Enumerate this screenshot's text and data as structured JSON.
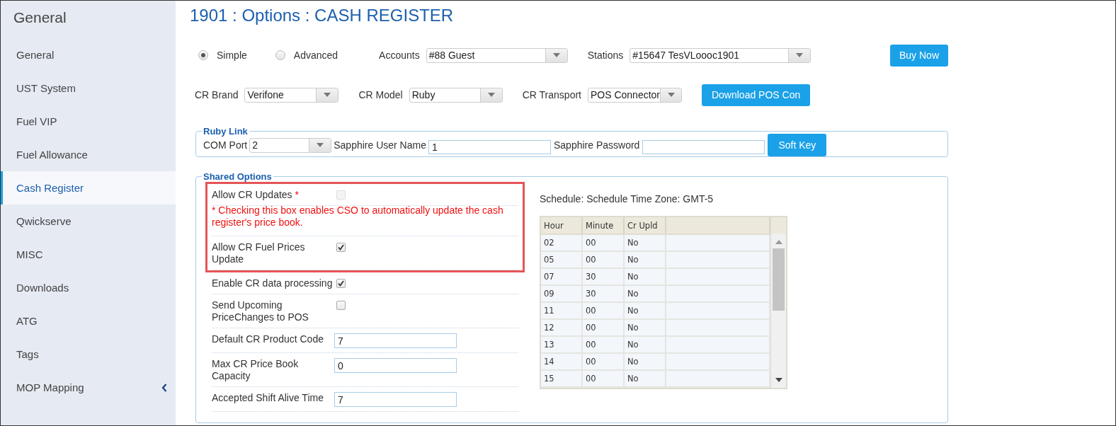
{
  "sidebar": {
    "title": "General",
    "items": [
      {
        "label": "General",
        "selected": false,
        "expandable": false
      },
      {
        "label": "UST System",
        "selected": false,
        "expandable": false
      },
      {
        "label": "Fuel VIP",
        "selected": false,
        "expandable": false
      },
      {
        "label": "Fuel Allowance",
        "selected": false,
        "expandable": false
      },
      {
        "label": "Cash Register",
        "selected": true,
        "expandable": false
      },
      {
        "label": "Qwickserve",
        "selected": false,
        "expandable": false
      },
      {
        "label": "MISC",
        "selected": false,
        "expandable": false
      },
      {
        "label": "Downloads",
        "selected": false,
        "expandable": false
      },
      {
        "label": "ATG",
        "selected": false,
        "expandable": false
      },
      {
        "label": "Tags",
        "selected": false,
        "expandable": false
      },
      {
        "label": "MOP Mapping",
        "selected": false,
        "expandable": true
      }
    ]
  },
  "page_title": "1901 : Options : CASH REGISTER",
  "mode": [
    {
      "label": "Simple",
      "selected": true
    },
    {
      "label": "Advanced",
      "selected": false
    }
  ],
  "selectors": [
    {
      "label": "Accounts",
      "value": "#88 Guest"
    },
    {
      "label": "Stations",
      "value": "#15647 TesVLoooc1901"
    }
  ],
  "buy_button": "Buy Now",
  "cr_settings": [
    {
      "label": "CR Brand",
      "value": "Verifone"
    },
    {
      "label": "CR Model",
      "value": "Ruby"
    },
    {
      "label": "CR Transport",
      "value": "POS Connector"
    }
  ],
  "download_button": "Download POS Con",
  "ruby_link": {
    "legend": "Ruby Link",
    "com_port": {
      "label": "COM Port",
      "value": "2"
    },
    "user_name": {
      "label": "Sapphire User Name",
      "value": "1"
    },
    "password": {
      "label": "Sapphire Password"
    },
    "button": "Soft Key"
  },
  "shared_options": {
    "legend": "Shared Options",
    "highlighted_rows": [
      {
        "kind": "checkbox",
        "label": "Allow CR Updates",
        "marker": "*",
        "checked": false,
        "disabled": true
      },
      {
        "kind": "note",
        "text": "* Checking this box enables CSO to automatically update the cash register's price book."
      },
      {
        "kind": "checkbox",
        "label": "Allow CR Fuel Prices Update",
        "checked": true,
        "disabled": false
      }
    ],
    "rows": [
      {
        "kind": "checkbox",
        "label": "Enable CR data processing",
        "checked": true,
        "disabled": false
      },
      {
        "kind": "checkbox",
        "label": "Send Upcoming PriceChanges to POS",
        "checked": false,
        "disabled": false
      },
      {
        "kind": "input",
        "label": "Default CR Product Code",
        "value": "7"
      },
      {
        "kind": "input",
        "label": "Max CR Price Book Capacity",
        "value": "0"
      },
      {
        "kind": "input",
        "label": "Accepted Shift Alive Time",
        "value": "7"
      }
    ]
  },
  "schedule": {
    "caption": "Schedule: Schedule Time Zone: GMT-5",
    "columns": [
      "Hour",
      "Minute",
      "Cr Upld"
    ],
    "rows": [
      [
        "02",
        "00",
        "No"
      ],
      [
        "05",
        "00",
        "No"
      ],
      [
        "07",
        "30",
        "No"
      ],
      [
        "09",
        "30",
        "No"
      ],
      [
        "11",
        "00",
        "No"
      ],
      [
        "12",
        "00",
        "No"
      ],
      [
        "13",
        "00",
        "No"
      ],
      [
        "14",
        "00",
        "No"
      ],
      [
        "15",
        "00",
        "No"
      ]
    ]
  }
}
